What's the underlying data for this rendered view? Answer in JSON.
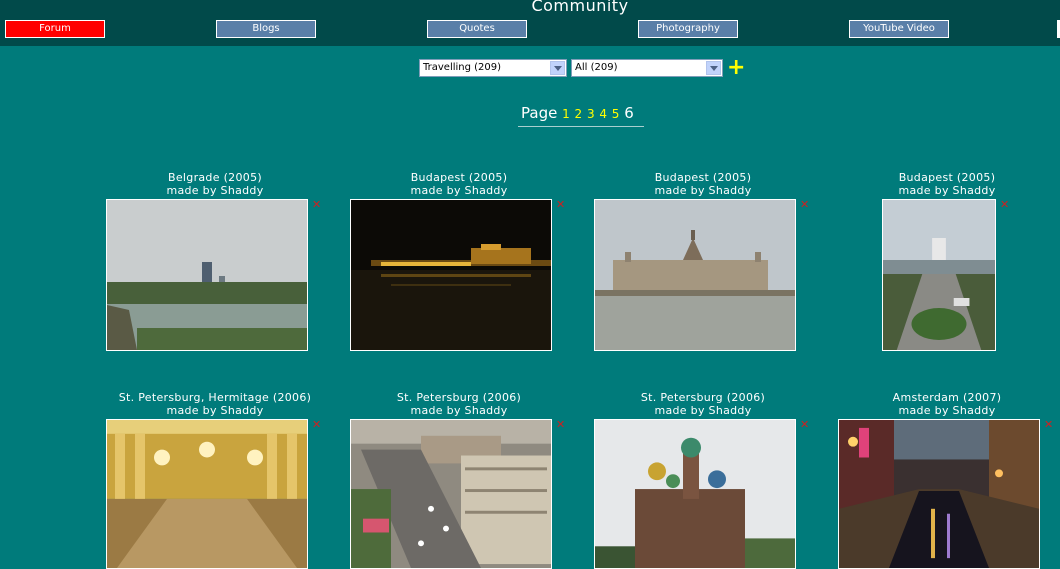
{
  "header": {
    "title": "Community",
    "nav": [
      "Forum",
      "Blogs",
      "Quotes",
      "Photography",
      "YouTube Video"
    ]
  },
  "filters": {
    "category_selected": "Travelling (209)",
    "subfilter_selected": "All (209)",
    "add_icon": "plus-icon"
  },
  "pager": {
    "label": "Page",
    "links": [
      "1",
      "2",
      "3",
      "4",
      "5"
    ],
    "current": "6"
  },
  "photos": [
    {
      "title": "Belgrade (2005)",
      "author": "made by Shaddy"
    },
    {
      "title": "Budapest (2005)",
      "author": "made by Shaddy"
    },
    {
      "title": "Budapest (2005)",
      "author": "made by Shaddy"
    },
    {
      "title": "Budapest (2005)",
      "author": "made by Shaddy"
    },
    {
      "title": "St. Petersburg, Hermitage (2006)",
      "author": "made by Shaddy"
    },
    {
      "title": "St. Petersburg (2006)",
      "author": "made by Shaddy"
    },
    {
      "title": "St. Petersburg (2006)",
      "author": "made by Shaddy"
    },
    {
      "title": "Amsterdam (2007)",
      "author": "made by Shaddy"
    }
  ],
  "delete_symbol": "✕",
  "colors": {
    "page_bg": "#007b7b",
    "header_bg": "#014a4a",
    "nav_bg": "#5a7fa8",
    "nav_active": "#ff0000",
    "page_link": "#ffff00",
    "delete": "#cc2222"
  }
}
